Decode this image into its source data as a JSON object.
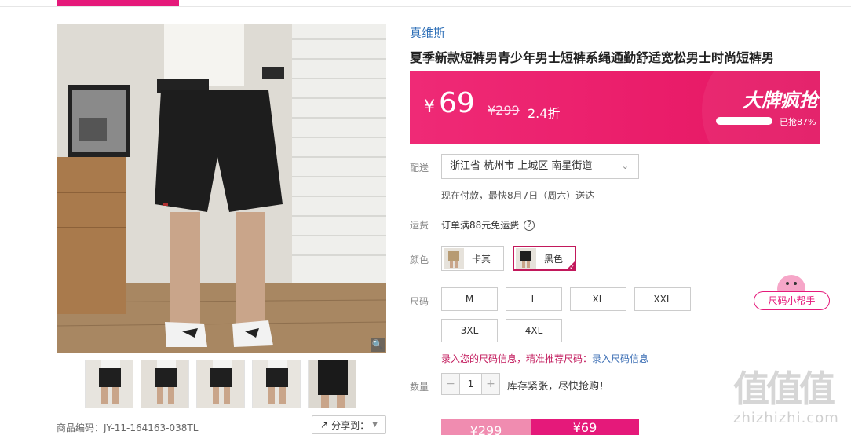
{
  "product": {
    "brand": "真维斯",
    "title": "夏季新款短裤男青少年男士短裤系绳通勤舒适宽松男士时尚短裤男",
    "sku_code": "商品编码：JY-11-164163-038TL",
    "share_label": "分享到："
  },
  "price": {
    "currency": "¥",
    "current": "69",
    "original": "¥299",
    "discount": "2.4折",
    "badge": "大牌疯抢",
    "sold_progress": 0.87,
    "sold_label": "已抢87%"
  },
  "delivery": {
    "label": "配送",
    "address": "浙江省 杭州市 上城区 南星街道",
    "note": "现在付款，最快8月7日（周六）送达"
  },
  "shipping": {
    "label": "运费",
    "text": "订单满88元免运费",
    "help_icon": "question-circle-icon"
  },
  "colors": {
    "label": "颜色",
    "options": [
      {
        "name": "卡其",
        "selected": false
      },
      {
        "name": "黑色",
        "selected": true
      }
    ]
  },
  "sizes": {
    "label": "尺码",
    "options": [
      "M",
      "L",
      "XL",
      "XXL",
      "3XL",
      "4XL"
    ],
    "helper": "尺码小帮手",
    "record_warn": "录入您的尺码信息，精准推荐尺码：",
    "record_link": "录入尺码信息"
  },
  "quantity": {
    "label": "数量",
    "value": "1",
    "minus": "−",
    "plus": "+",
    "stock_text": "库存紧张，尽快抢购！"
  },
  "buy": {
    "left_price": "¥299",
    "right_price": "¥69"
  },
  "watermark": {
    "glyphs": "值值值",
    "domain": "zhizhizhi.com"
  },
  "colors_theme": {
    "accent": "#e5197a",
    "banner": "#ea1d6a",
    "link": "#2e6fb7"
  }
}
